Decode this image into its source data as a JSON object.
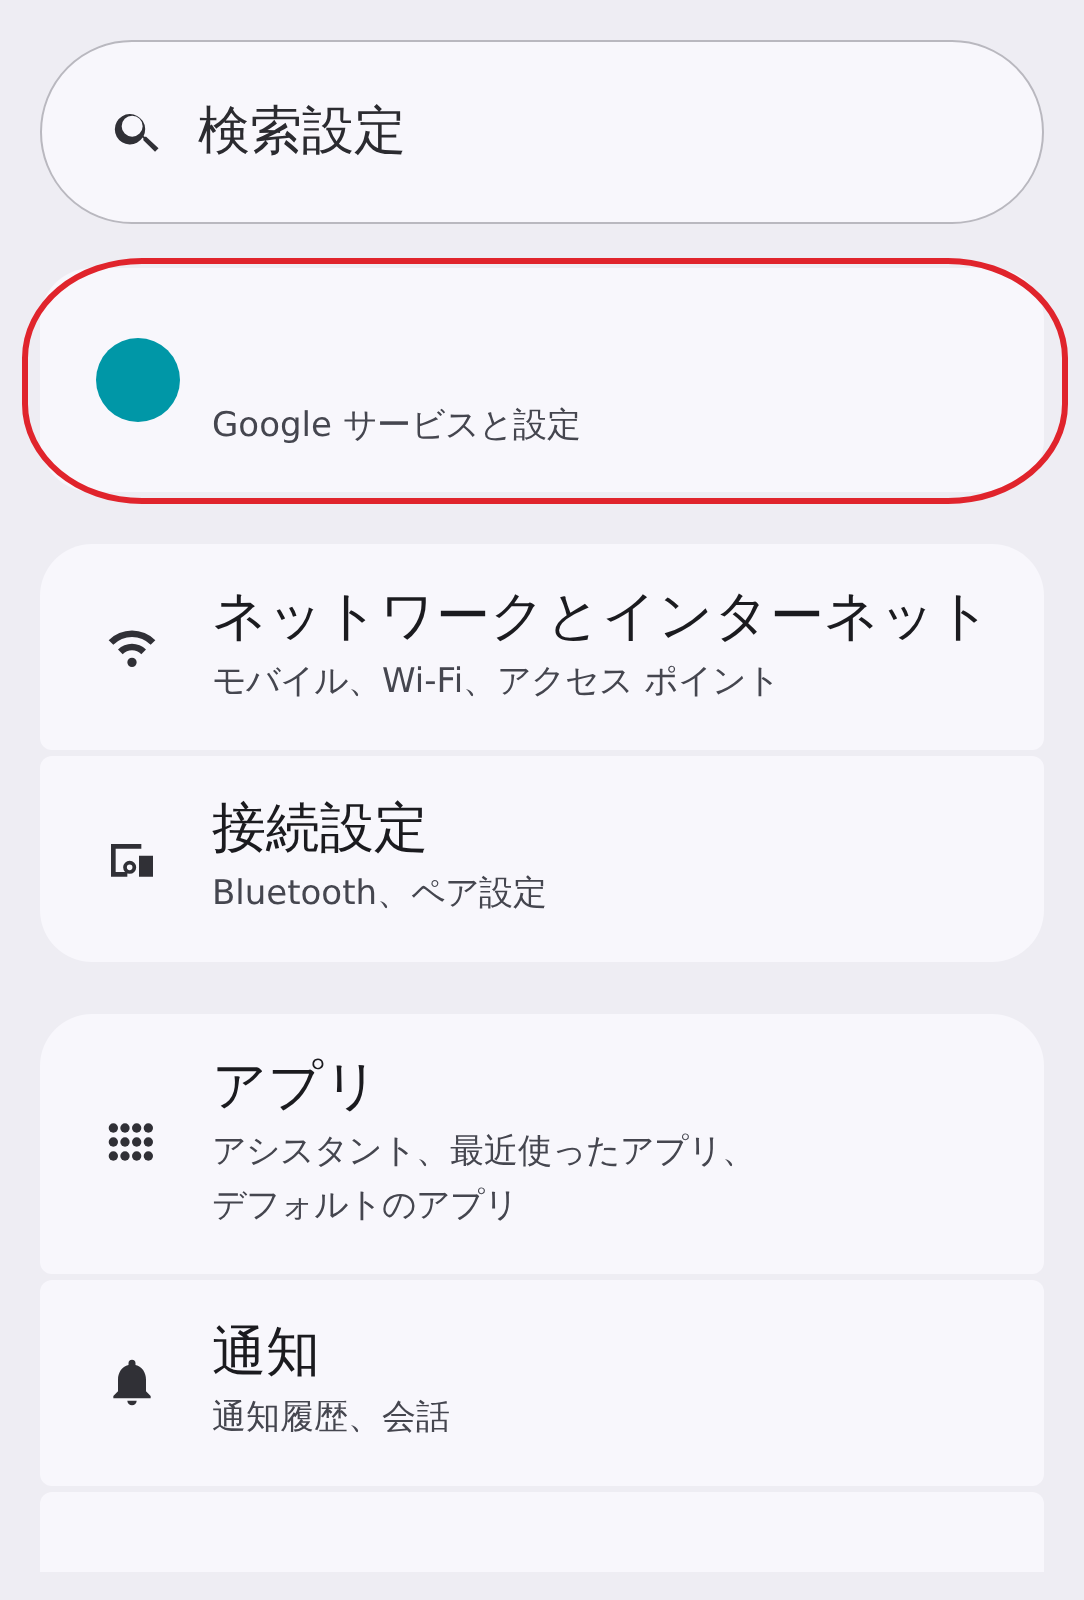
{
  "search": {
    "placeholder": "検索設定"
  },
  "account": {
    "subtitle": "Google サービスと設定",
    "highlighted": true
  },
  "groups": [
    {
      "items": [
        {
          "title": "ネットワークとインターネット",
          "subtitle": "モバイル、Wi-Fi、アクセス ポイント"
        },
        {
          "title": "接続設定",
          "subtitle": "Bluetooth、ペア設定"
        }
      ],
      "more_below": false
    },
    {
      "items": [
        {
          "title": "アプリ",
          "subtitle": "アシスタント、最近使ったアプリ、デフォルトのアプリ"
        },
        {
          "title": "通知",
          "subtitle": "通知履歴、会話"
        }
      ],
      "more_below": true
    }
  ]
}
